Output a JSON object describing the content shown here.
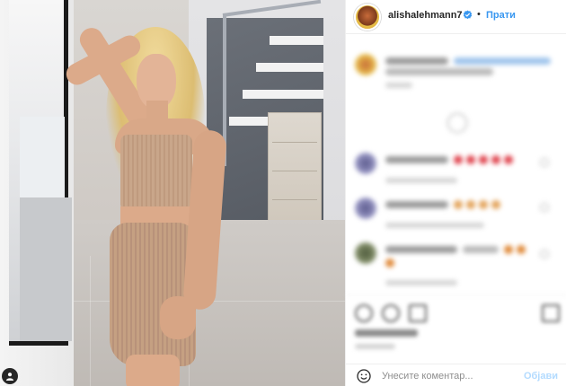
{
  "header": {
    "username": "alishalehmann7",
    "separator": "•",
    "follow_label": "Прати"
  },
  "comment_box": {
    "placeholder": "Унесите коментар...",
    "post_label": "Објави"
  },
  "icons": {
    "verified": "verified-badge-icon",
    "tag": "tagged-user-icon",
    "emoji": "smile-icon"
  },
  "colors": {
    "link_blue": "#3897f0",
    "post_disabled": "#b3dbff",
    "verified_blue": "#3897f0"
  }
}
